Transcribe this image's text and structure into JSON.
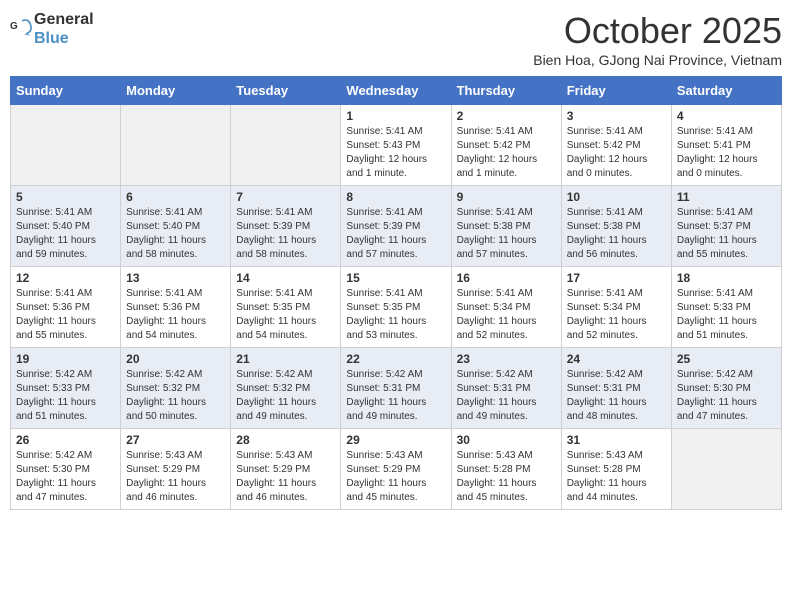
{
  "logo": {
    "line1": "General",
    "line2": "Blue"
  },
  "title": "October 2025",
  "subtitle": "Bien Hoa, GJong Nai Province, Vietnam",
  "days_of_week": [
    "Sunday",
    "Monday",
    "Tuesday",
    "Wednesday",
    "Thursday",
    "Friday",
    "Saturday"
  ],
  "weeks": [
    [
      {
        "day": "",
        "sunrise": "",
        "sunset": "",
        "daylight": ""
      },
      {
        "day": "",
        "sunrise": "",
        "sunset": "",
        "daylight": ""
      },
      {
        "day": "",
        "sunrise": "",
        "sunset": "",
        "daylight": ""
      },
      {
        "day": "1",
        "sunrise": "Sunrise: 5:41 AM",
        "sunset": "Sunset: 5:43 PM",
        "daylight": "Daylight: 12 hours and 1 minute."
      },
      {
        "day": "2",
        "sunrise": "Sunrise: 5:41 AM",
        "sunset": "Sunset: 5:42 PM",
        "daylight": "Daylight: 12 hours and 1 minute."
      },
      {
        "day": "3",
        "sunrise": "Sunrise: 5:41 AM",
        "sunset": "Sunset: 5:42 PM",
        "daylight": "Daylight: 12 hours and 0 minutes."
      },
      {
        "day": "4",
        "sunrise": "Sunrise: 5:41 AM",
        "sunset": "Sunset: 5:41 PM",
        "daylight": "Daylight: 12 hours and 0 minutes."
      }
    ],
    [
      {
        "day": "5",
        "sunrise": "Sunrise: 5:41 AM",
        "sunset": "Sunset: 5:40 PM",
        "daylight": "Daylight: 11 hours and 59 minutes."
      },
      {
        "day": "6",
        "sunrise": "Sunrise: 5:41 AM",
        "sunset": "Sunset: 5:40 PM",
        "daylight": "Daylight: 11 hours and 58 minutes."
      },
      {
        "day": "7",
        "sunrise": "Sunrise: 5:41 AM",
        "sunset": "Sunset: 5:39 PM",
        "daylight": "Daylight: 11 hours and 58 minutes."
      },
      {
        "day": "8",
        "sunrise": "Sunrise: 5:41 AM",
        "sunset": "Sunset: 5:39 PM",
        "daylight": "Daylight: 11 hours and 57 minutes."
      },
      {
        "day": "9",
        "sunrise": "Sunrise: 5:41 AM",
        "sunset": "Sunset: 5:38 PM",
        "daylight": "Daylight: 11 hours and 57 minutes."
      },
      {
        "day": "10",
        "sunrise": "Sunrise: 5:41 AM",
        "sunset": "Sunset: 5:38 PM",
        "daylight": "Daylight: 11 hours and 56 minutes."
      },
      {
        "day": "11",
        "sunrise": "Sunrise: 5:41 AM",
        "sunset": "Sunset: 5:37 PM",
        "daylight": "Daylight: 11 hours and 55 minutes."
      }
    ],
    [
      {
        "day": "12",
        "sunrise": "Sunrise: 5:41 AM",
        "sunset": "Sunset: 5:36 PM",
        "daylight": "Daylight: 11 hours and 55 minutes."
      },
      {
        "day": "13",
        "sunrise": "Sunrise: 5:41 AM",
        "sunset": "Sunset: 5:36 PM",
        "daylight": "Daylight: 11 hours and 54 minutes."
      },
      {
        "day": "14",
        "sunrise": "Sunrise: 5:41 AM",
        "sunset": "Sunset: 5:35 PM",
        "daylight": "Daylight: 11 hours and 54 minutes."
      },
      {
        "day": "15",
        "sunrise": "Sunrise: 5:41 AM",
        "sunset": "Sunset: 5:35 PM",
        "daylight": "Daylight: 11 hours and 53 minutes."
      },
      {
        "day": "16",
        "sunrise": "Sunrise: 5:41 AM",
        "sunset": "Sunset: 5:34 PM",
        "daylight": "Daylight: 11 hours and 52 minutes."
      },
      {
        "day": "17",
        "sunrise": "Sunrise: 5:41 AM",
        "sunset": "Sunset: 5:34 PM",
        "daylight": "Daylight: 11 hours and 52 minutes."
      },
      {
        "day": "18",
        "sunrise": "Sunrise: 5:41 AM",
        "sunset": "Sunset: 5:33 PM",
        "daylight": "Daylight: 11 hours and 51 minutes."
      }
    ],
    [
      {
        "day": "19",
        "sunrise": "Sunrise: 5:42 AM",
        "sunset": "Sunset: 5:33 PM",
        "daylight": "Daylight: 11 hours and 51 minutes."
      },
      {
        "day": "20",
        "sunrise": "Sunrise: 5:42 AM",
        "sunset": "Sunset: 5:32 PM",
        "daylight": "Daylight: 11 hours and 50 minutes."
      },
      {
        "day": "21",
        "sunrise": "Sunrise: 5:42 AM",
        "sunset": "Sunset: 5:32 PM",
        "daylight": "Daylight: 11 hours and 49 minutes."
      },
      {
        "day": "22",
        "sunrise": "Sunrise: 5:42 AM",
        "sunset": "Sunset: 5:31 PM",
        "daylight": "Daylight: 11 hours and 49 minutes."
      },
      {
        "day": "23",
        "sunrise": "Sunrise: 5:42 AM",
        "sunset": "Sunset: 5:31 PM",
        "daylight": "Daylight: 11 hours and 49 minutes."
      },
      {
        "day": "24",
        "sunrise": "Sunrise: 5:42 AM",
        "sunset": "Sunset: 5:31 PM",
        "daylight": "Daylight: 11 hours and 48 minutes."
      },
      {
        "day": "25",
        "sunrise": "Sunrise: 5:42 AM",
        "sunset": "Sunset: 5:30 PM",
        "daylight": "Daylight: 11 hours and 47 minutes."
      }
    ],
    [
      {
        "day": "26",
        "sunrise": "Sunrise: 5:42 AM",
        "sunset": "Sunset: 5:30 PM",
        "daylight": "Daylight: 11 hours and 47 minutes."
      },
      {
        "day": "27",
        "sunrise": "Sunrise: 5:43 AM",
        "sunset": "Sunset: 5:29 PM",
        "daylight": "Daylight: 11 hours and 46 minutes."
      },
      {
        "day": "28",
        "sunrise": "Sunrise: 5:43 AM",
        "sunset": "Sunset: 5:29 PM",
        "daylight": "Daylight: 11 hours and 46 minutes."
      },
      {
        "day": "29",
        "sunrise": "Sunrise: 5:43 AM",
        "sunset": "Sunset: 5:29 PM",
        "daylight": "Daylight: 11 hours and 45 minutes."
      },
      {
        "day": "30",
        "sunrise": "Sunrise: 5:43 AM",
        "sunset": "Sunset: 5:28 PM",
        "daylight": "Daylight: 11 hours and 45 minutes."
      },
      {
        "day": "31",
        "sunrise": "Sunrise: 5:43 AM",
        "sunset": "Sunset: 5:28 PM",
        "daylight": "Daylight: 11 hours and 44 minutes."
      },
      {
        "day": "",
        "sunrise": "",
        "sunset": "",
        "daylight": ""
      }
    ]
  ]
}
